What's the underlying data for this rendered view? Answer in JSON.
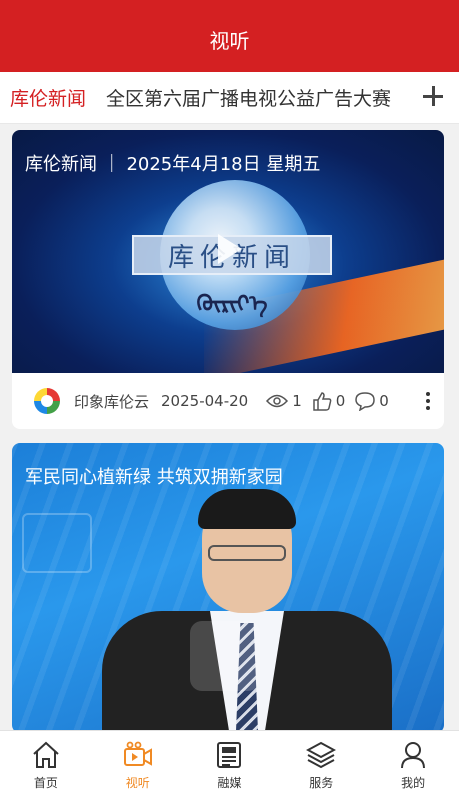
{
  "header": {
    "title": "视听"
  },
  "tabs": [
    {
      "label": "库伦新闻",
      "active": true
    },
    {
      "label": "全区第六届广播电视公益广告大赛",
      "active": false
    }
  ],
  "cards": [
    {
      "title": "库伦新闻  ｜  2025年4月18日  星期五",
      "program_logo": "库伦新闻",
      "program_logo_script": "ᠬᠦᠷᠢᠶ᠎ᠡ",
      "source": "印象库伦云",
      "date": "2025-04-20",
      "views": "1",
      "likes": "0",
      "comments": "0"
    },
    {
      "title": "军民同心植新绿  共筑双拥新家园"
    }
  ],
  "bottom_nav": [
    {
      "label": "首页",
      "icon": "home-icon",
      "active": false
    },
    {
      "label": "视听",
      "icon": "video-icon",
      "active": true
    },
    {
      "label": "融媒",
      "icon": "newspaper-icon",
      "active": false
    },
    {
      "label": "服务",
      "icon": "layers-icon",
      "active": false
    },
    {
      "label": "我的",
      "icon": "user-icon",
      "active": false
    }
  ],
  "colors": {
    "brand_red": "#d42022",
    "active_orange": "#f08a24"
  }
}
